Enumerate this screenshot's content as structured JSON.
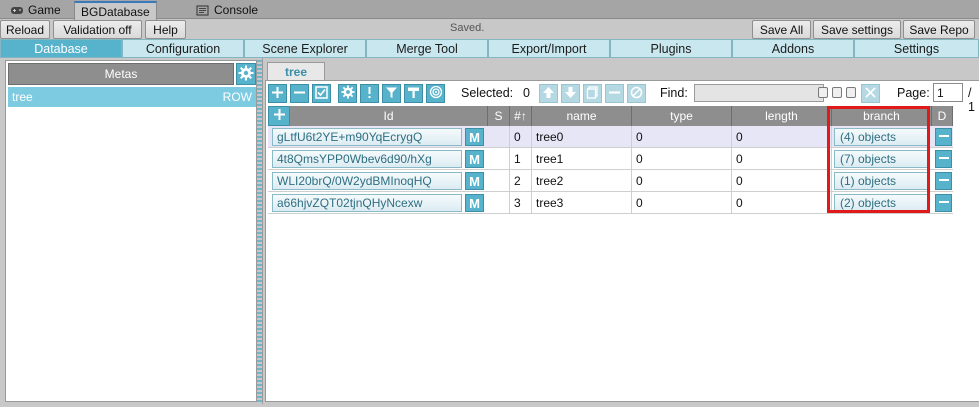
{
  "window_tabs": [
    {
      "label": "Game",
      "icon": "gamepad-icon"
    },
    {
      "label": "BGDatabase",
      "icon": ""
    },
    {
      "label": "Console",
      "icon": "console-icon"
    }
  ],
  "toolbar": {
    "reload": "Reload",
    "validation": "Validation off",
    "help": "Help",
    "status": "Saved.",
    "save_all": "Save All",
    "save_settings": "Save settings",
    "save_repo": "Save Repo"
  },
  "nav_tabs": [
    "Database",
    "Configuration",
    "Scene Explorer",
    "Merge Tool",
    "Export/Import",
    "Plugins",
    "Addons",
    "Settings"
  ],
  "metas": {
    "header": "Metas",
    "items": [
      {
        "name": "tree",
        "type": "ROW"
      }
    ]
  },
  "meta_tab": "tree",
  "table_toolbar": {
    "selected_label": "Selected:",
    "selected_count": "0",
    "find_label": "Find:",
    "find_value": "",
    "page_label": "Page:",
    "page_value": "1",
    "page_total": "/ 1"
  },
  "columns": [
    "Id",
    "S",
    "#↑",
    "name",
    "type",
    "length",
    "branch",
    "D"
  ],
  "rows": [
    {
      "id": "gLtfU6t2YE+m90YqEcrygQ",
      "num": "0",
      "name": "tree0",
      "type": "0",
      "length": "0",
      "branch": "(4) objects"
    },
    {
      "id": "4t8QmsYPP0Wbev6d90/hXg",
      "num": "1",
      "name": "tree1",
      "type": "0",
      "length": "0",
      "branch": "(7) objects"
    },
    {
      "id": "WLI20brQ/0W2ydBMInoqHQ",
      "num": "2",
      "name": "tree2",
      "type": "0",
      "length": "0",
      "branch": "(1) objects"
    },
    {
      "id": "a66hjvZQT02tjnQHyNcexw",
      "num": "3",
      "name": "tree3",
      "type": "0",
      "length": "0",
      "branch": "(2) objects"
    }
  ],
  "m_label": "M",
  "colors": {
    "accent": "#57b2cb",
    "highlight": "#e01a1a",
    "selected_row": "#e6e6f6"
  }
}
